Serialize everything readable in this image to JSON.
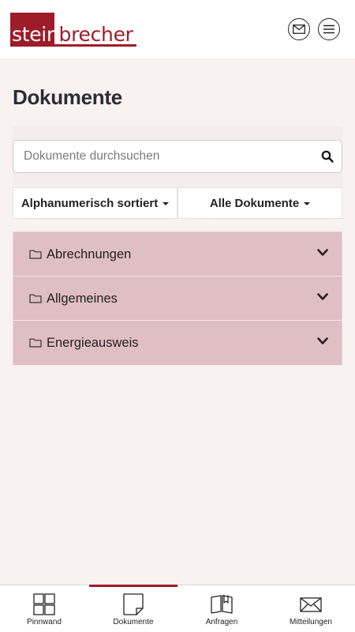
{
  "header": {
    "logo_white": "stein",
    "logo_red": "brecher",
    "brand_color": "#9e1c28",
    "mail_icon": "mail-icon",
    "menu_icon": "menu-icon"
  },
  "page": {
    "title": "Dokumente"
  },
  "search": {
    "placeholder": "Dokumente durchsuchen",
    "value": ""
  },
  "filters": {
    "sort_label": "Alphanumerisch sortiert",
    "type_label": "Alle Dokumente"
  },
  "folders": [
    {
      "label": "Abrechnungen"
    },
    {
      "label": "Allgemeines"
    },
    {
      "label": "Energieausweis"
    }
  ],
  "nav": {
    "active": "Dokumente",
    "items": [
      {
        "label": "Pinnwand",
        "icon": "grid-icon"
      },
      {
        "label": "Dokumente",
        "icon": "document-icon"
      },
      {
        "label": "Anfragen",
        "icon": "book-icon"
      },
      {
        "label": "Mitteilungen",
        "icon": "envelope-icon"
      }
    ]
  },
  "colors": {
    "background": "#f9f2f2",
    "folder_bg": "#e0bfc4",
    "accent": "#9e1c28"
  }
}
